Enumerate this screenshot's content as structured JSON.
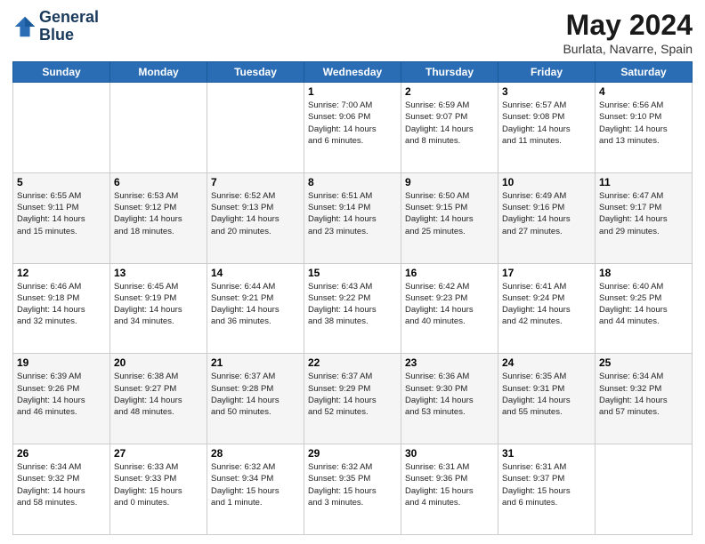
{
  "header": {
    "logo_line1": "General",
    "logo_line2": "Blue",
    "main_title": "May 2024",
    "subtitle": "Burlata, Navarre, Spain"
  },
  "calendar": {
    "weekdays": [
      "Sunday",
      "Monday",
      "Tuesday",
      "Wednesday",
      "Thursday",
      "Friday",
      "Saturday"
    ],
    "weeks": [
      [
        {
          "day": "",
          "info": ""
        },
        {
          "day": "",
          "info": ""
        },
        {
          "day": "",
          "info": ""
        },
        {
          "day": "1",
          "info": "Sunrise: 7:00 AM\nSunset: 9:06 PM\nDaylight: 14 hours\nand 6 minutes."
        },
        {
          "day": "2",
          "info": "Sunrise: 6:59 AM\nSunset: 9:07 PM\nDaylight: 14 hours\nand 8 minutes."
        },
        {
          "day": "3",
          "info": "Sunrise: 6:57 AM\nSunset: 9:08 PM\nDaylight: 14 hours\nand 11 minutes."
        },
        {
          "day": "4",
          "info": "Sunrise: 6:56 AM\nSunset: 9:10 PM\nDaylight: 14 hours\nand 13 minutes."
        }
      ],
      [
        {
          "day": "5",
          "info": "Sunrise: 6:55 AM\nSunset: 9:11 PM\nDaylight: 14 hours\nand 15 minutes."
        },
        {
          "day": "6",
          "info": "Sunrise: 6:53 AM\nSunset: 9:12 PM\nDaylight: 14 hours\nand 18 minutes."
        },
        {
          "day": "7",
          "info": "Sunrise: 6:52 AM\nSunset: 9:13 PM\nDaylight: 14 hours\nand 20 minutes."
        },
        {
          "day": "8",
          "info": "Sunrise: 6:51 AM\nSunset: 9:14 PM\nDaylight: 14 hours\nand 23 minutes."
        },
        {
          "day": "9",
          "info": "Sunrise: 6:50 AM\nSunset: 9:15 PM\nDaylight: 14 hours\nand 25 minutes."
        },
        {
          "day": "10",
          "info": "Sunrise: 6:49 AM\nSunset: 9:16 PM\nDaylight: 14 hours\nand 27 minutes."
        },
        {
          "day": "11",
          "info": "Sunrise: 6:47 AM\nSunset: 9:17 PM\nDaylight: 14 hours\nand 29 minutes."
        }
      ],
      [
        {
          "day": "12",
          "info": "Sunrise: 6:46 AM\nSunset: 9:18 PM\nDaylight: 14 hours\nand 32 minutes."
        },
        {
          "day": "13",
          "info": "Sunrise: 6:45 AM\nSunset: 9:19 PM\nDaylight: 14 hours\nand 34 minutes."
        },
        {
          "day": "14",
          "info": "Sunrise: 6:44 AM\nSunset: 9:21 PM\nDaylight: 14 hours\nand 36 minutes."
        },
        {
          "day": "15",
          "info": "Sunrise: 6:43 AM\nSunset: 9:22 PM\nDaylight: 14 hours\nand 38 minutes."
        },
        {
          "day": "16",
          "info": "Sunrise: 6:42 AM\nSunset: 9:23 PM\nDaylight: 14 hours\nand 40 minutes."
        },
        {
          "day": "17",
          "info": "Sunrise: 6:41 AM\nSunset: 9:24 PM\nDaylight: 14 hours\nand 42 minutes."
        },
        {
          "day": "18",
          "info": "Sunrise: 6:40 AM\nSunset: 9:25 PM\nDaylight: 14 hours\nand 44 minutes."
        }
      ],
      [
        {
          "day": "19",
          "info": "Sunrise: 6:39 AM\nSunset: 9:26 PM\nDaylight: 14 hours\nand 46 minutes."
        },
        {
          "day": "20",
          "info": "Sunrise: 6:38 AM\nSunset: 9:27 PM\nDaylight: 14 hours\nand 48 minutes."
        },
        {
          "day": "21",
          "info": "Sunrise: 6:37 AM\nSunset: 9:28 PM\nDaylight: 14 hours\nand 50 minutes."
        },
        {
          "day": "22",
          "info": "Sunrise: 6:37 AM\nSunset: 9:29 PM\nDaylight: 14 hours\nand 52 minutes."
        },
        {
          "day": "23",
          "info": "Sunrise: 6:36 AM\nSunset: 9:30 PM\nDaylight: 14 hours\nand 53 minutes."
        },
        {
          "day": "24",
          "info": "Sunrise: 6:35 AM\nSunset: 9:31 PM\nDaylight: 14 hours\nand 55 minutes."
        },
        {
          "day": "25",
          "info": "Sunrise: 6:34 AM\nSunset: 9:32 PM\nDaylight: 14 hours\nand 57 minutes."
        }
      ],
      [
        {
          "day": "26",
          "info": "Sunrise: 6:34 AM\nSunset: 9:32 PM\nDaylight: 14 hours\nand 58 minutes."
        },
        {
          "day": "27",
          "info": "Sunrise: 6:33 AM\nSunset: 9:33 PM\nDaylight: 15 hours\nand 0 minutes."
        },
        {
          "day": "28",
          "info": "Sunrise: 6:32 AM\nSunset: 9:34 PM\nDaylight: 15 hours\nand 1 minute."
        },
        {
          "day": "29",
          "info": "Sunrise: 6:32 AM\nSunset: 9:35 PM\nDaylight: 15 hours\nand 3 minutes."
        },
        {
          "day": "30",
          "info": "Sunrise: 6:31 AM\nSunset: 9:36 PM\nDaylight: 15 hours\nand 4 minutes."
        },
        {
          "day": "31",
          "info": "Sunrise: 6:31 AM\nSunset: 9:37 PM\nDaylight: 15 hours\nand 6 minutes."
        },
        {
          "day": "",
          "info": ""
        }
      ]
    ]
  }
}
